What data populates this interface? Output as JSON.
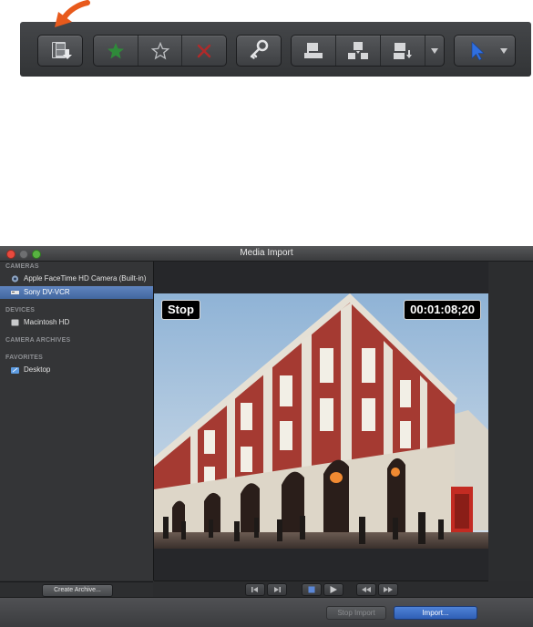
{
  "toolbar": {
    "buttons": [
      {
        "name": "import-media-button",
        "icon": "film-import-icon"
      },
      {
        "name": "favorite-button",
        "icon": "green-star-icon",
        "color": "#2f8a3a"
      },
      {
        "name": "unrate-button",
        "icon": "outline-star-icon"
      },
      {
        "name": "reject-button",
        "icon": "red-x-icon",
        "color": "#b02a2a"
      },
      {
        "name": "keyword-button",
        "icon": "key-icon"
      },
      {
        "name": "connect-clip-button",
        "icon": "connect-icon"
      },
      {
        "name": "insert-clip-button",
        "icon": "insert-icon"
      },
      {
        "name": "append-clip-button",
        "icon": "append-icon"
      },
      {
        "name": "edit-options-button",
        "icon": "chevron-down-icon"
      },
      {
        "name": "select-tool-button",
        "icon": "arrow-pointer-icon",
        "color": "#2f6fe0"
      }
    ],
    "callout_color": "#e85a1c"
  },
  "window": {
    "title": "Media Import"
  },
  "sidebar": {
    "cameras_heading": "CAMERAS",
    "cameras": [
      {
        "label": "Apple FaceTime HD Camera (Built-in)",
        "icon": "camera-icon",
        "selected": false
      },
      {
        "label": "Sony DV-VCR",
        "icon": "vcr-icon",
        "selected": true
      }
    ],
    "devices_heading": "DEVICES",
    "devices": [
      {
        "label": "Macintosh HD",
        "icon": "hard-drive-icon"
      }
    ],
    "archives_heading": "CAMERA ARCHIVES",
    "favorites_heading": "FAVORITES",
    "favorites": [
      {
        "label": "Desktop",
        "icon": "desktop-folder-icon"
      }
    ],
    "create_archive_label": "Create Archive..."
  },
  "preview": {
    "status_text": "Stop",
    "timecode": "00:01:08;20"
  },
  "transport": {
    "buttons": [
      "previous-frame",
      "next-frame",
      "stop",
      "play",
      "rewind",
      "fast-forward"
    ]
  },
  "footer": {
    "stop_import_label": "Stop Import",
    "import_label": "Import..."
  },
  "colors": {
    "selection": "#4f74ad",
    "accent_blue": "#2f5fb5"
  }
}
